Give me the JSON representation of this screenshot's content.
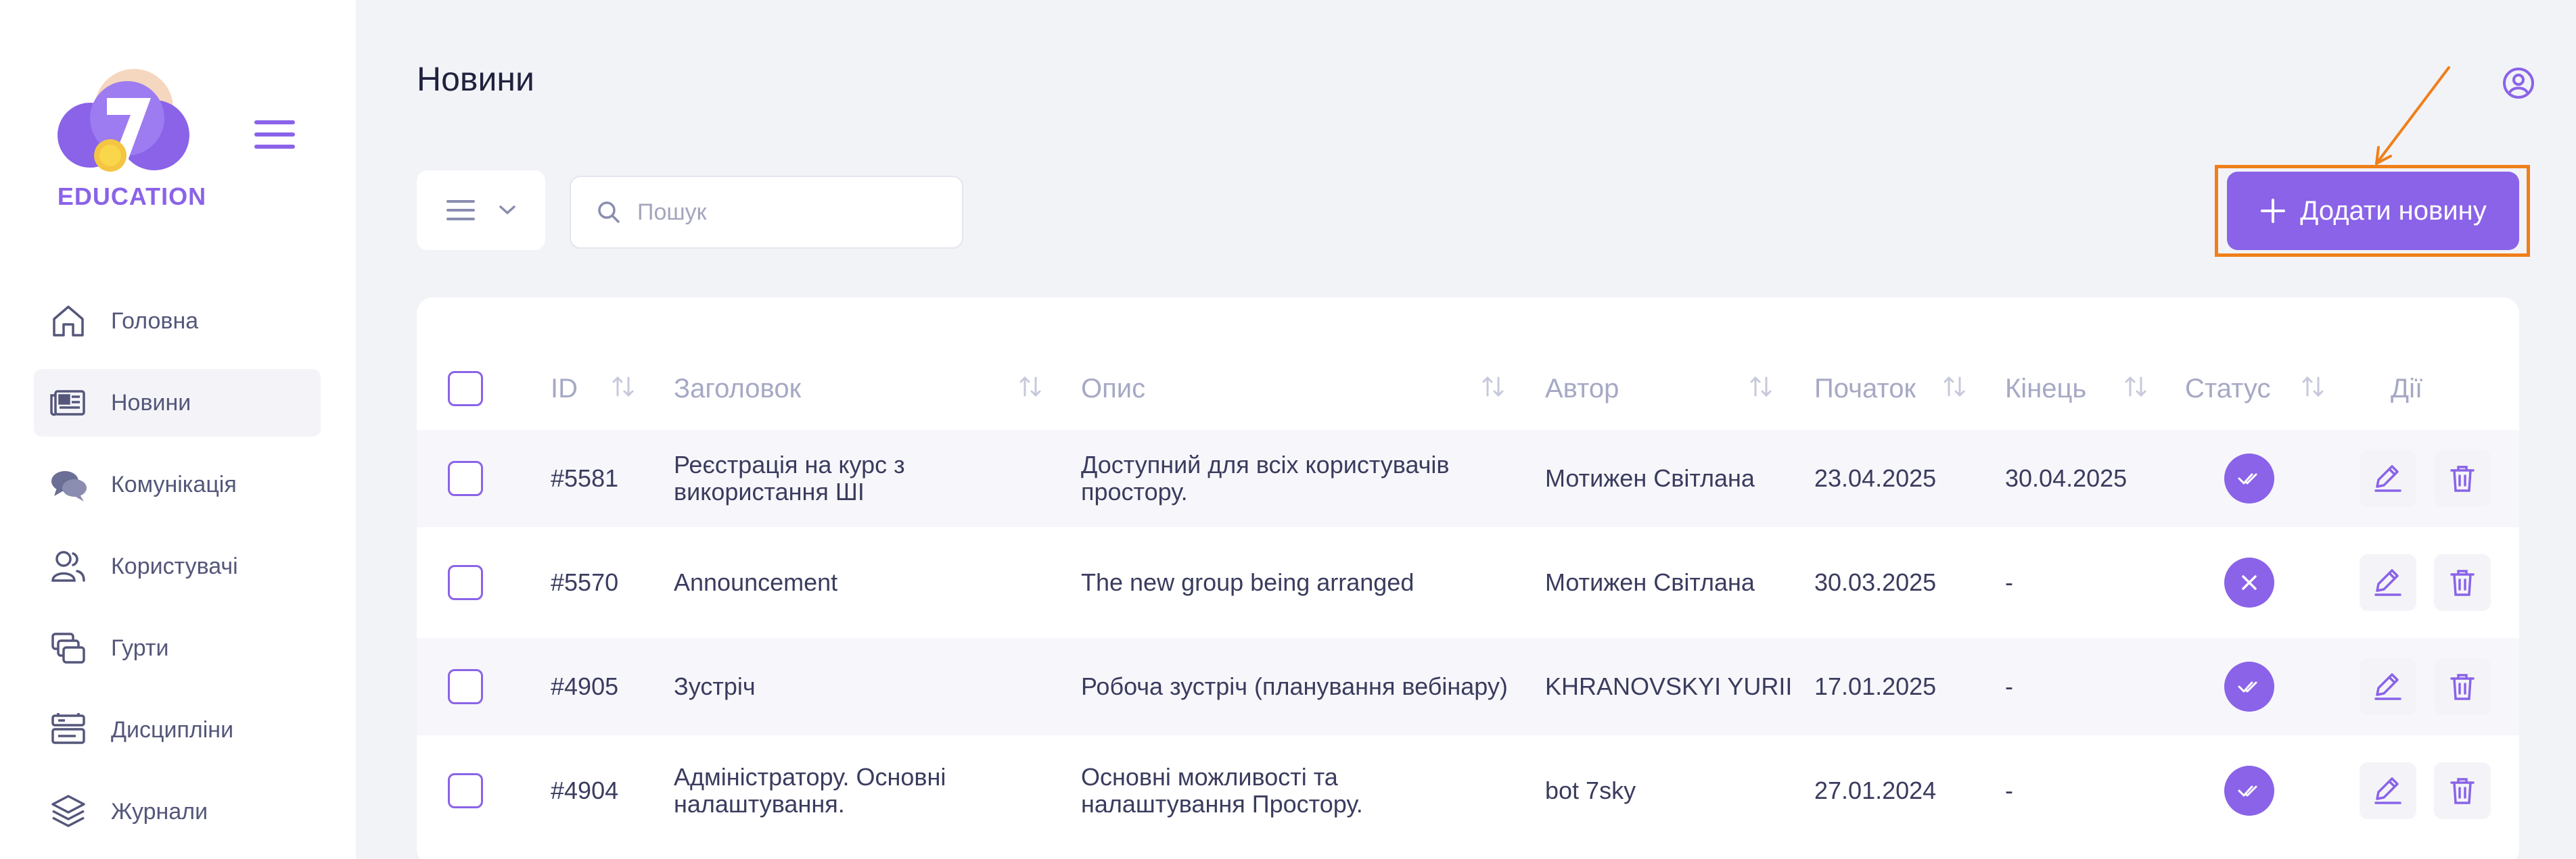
{
  "brand": {
    "name": "EDUCATION",
    "accent": "#8a63e8",
    "highlight": "#f07f1a"
  },
  "sidebar": {
    "items": [
      {
        "label": "Головна",
        "icon": "home-icon",
        "active": false
      },
      {
        "label": "Новини",
        "icon": "newspaper-icon",
        "active": true
      },
      {
        "label": "Комунікація",
        "icon": "chat-icon",
        "active": false
      },
      {
        "label": "Користувачі",
        "icon": "users-icon",
        "active": false
      },
      {
        "label": "Гурти",
        "icon": "groups-icon",
        "active": false
      },
      {
        "label": "Дисципліни",
        "icon": "disciplines-icon",
        "active": false
      },
      {
        "label": "Журнали",
        "icon": "layers-icon",
        "active": false
      }
    ]
  },
  "header": {
    "title": "Новини"
  },
  "toolbar": {
    "search_placeholder": "Пошук",
    "add_label": "Додати новину"
  },
  "table": {
    "columns": {
      "id": "ID",
      "title": "Заголовок",
      "description": "Опис",
      "author": "Автор",
      "start": "Початок",
      "end": "Кінець",
      "status": "Статус",
      "actions": "Дії"
    },
    "rows": [
      {
        "id": "#5581",
        "title": "Реєстрація на курс з використання ШІ",
        "description": "Доступний для всіх користувачів простору.",
        "author": "Мотижен Світлана",
        "start": "23.04.2025",
        "end": "30.04.2025",
        "status": "published"
      },
      {
        "id": "#5570",
        "title": "Announcement",
        "description": "The new group being arranged",
        "author": "Мотижен Світлана",
        "start": "30.03.2025",
        "end": "-",
        "status": "unpublished"
      },
      {
        "id": "#4905",
        "title": "Зустріч",
        "description": "Робоча зустріч (планування вебінару)",
        "author": "KHRANOVSKYI YURII",
        "start": "17.01.2025",
        "end": "-",
        "status": "published"
      },
      {
        "id": "#4904",
        "title": "Адміністратору. Основні налаштування.",
        "description": "Основні можливості та налаштування Простору.",
        "author": "bot 7sky",
        "start": "27.01.2024",
        "end": "-",
        "status": "published"
      }
    ]
  }
}
